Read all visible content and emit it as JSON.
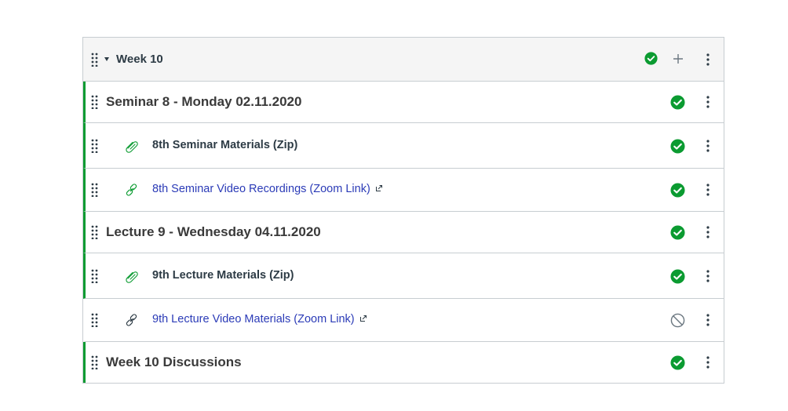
{
  "module": {
    "title": "Week 10",
    "status": "published",
    "items": [
      {
        "type": "subheader",
        "title": "Seminar 8 - Monday 02.11.2020",
        "status": "published"
      },
      {
        "type": "attachment",
        "title": "8th Seminar Materials (Zip)",
        "status": "published",
        "icon": "paperclip-icon"
      },
      {
        "type": "external-link",
        "title": "8th Seminar Video Recordings (Zoom Link)",
        "status": "published",
        "icon": "link-icon"
      },
      {
        "type": "subheader",
        "title": "Lecture 9 - Wednesday 04.11.2020",
        "status": "published"
      },
      {
        "type": "attachment",
        "title": "9th Lecture Materials (Zip)",
        "status": "published",
        "icon": "paperclip-icon"
      },
      {
        "type": "external-link",
        "title": "9th Lecture Video Materials (Zoom Link)",
        "status": "unpublished",
        "icon": "link-icon"
      },
      {
        "type": "subheader",
        "title": "Week 10 Discussions",
        "status": "published"
      }
    ]
  },
  "colors": {
    "published": "#0b9b31",
    "unpublished": "#6b7780",
    "link": "#2b3bb7",
    "header_bg": "#f5f5f5",
    "border": "#c7cdd1"
  }
}
